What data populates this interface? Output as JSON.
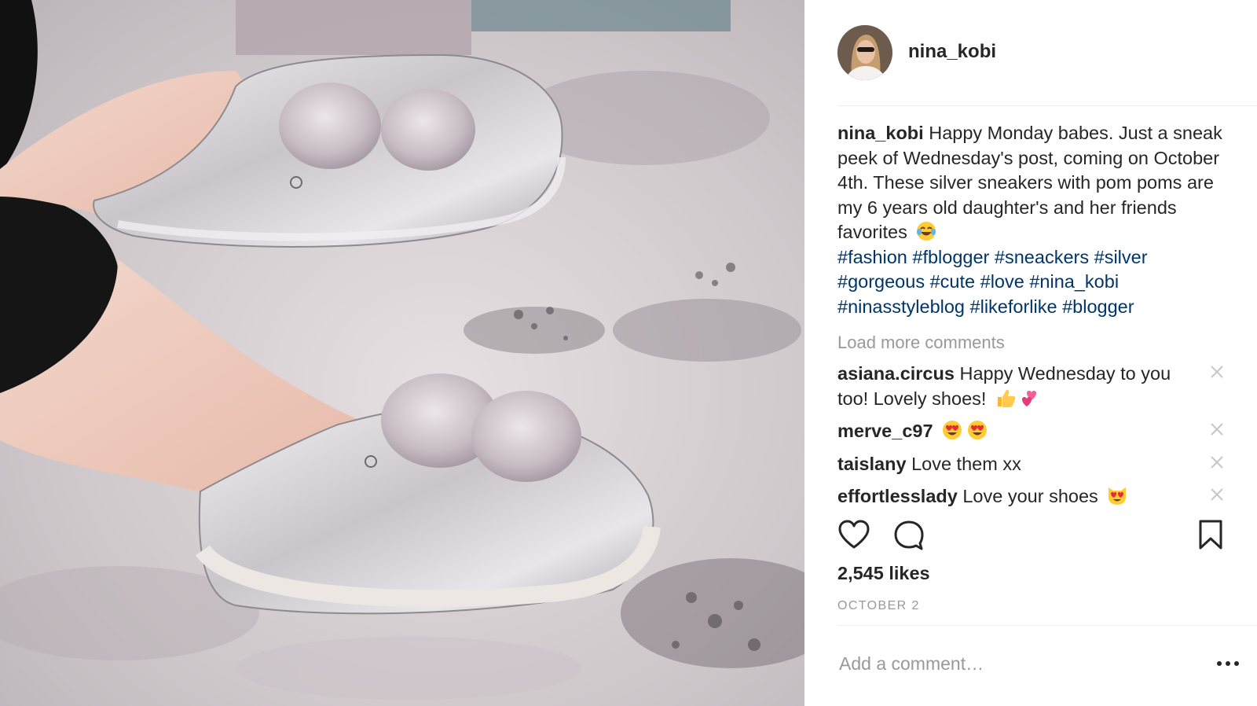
{
  "post": {
    "username": "nina_kobi",
    "caption": {
      "username": "nina_kobi",
      "text": "Happy Monday babes. Just a sneak peek of Wednesday's post, coming on October 4th. These silver sneakers with pom poms are my 6 years old daughter's and her friends favorites",
      "emoji": "face-with-tears-of-joy-emoji",
      "hashtags": [
        "#fashion",
        "#fblogger",
        "#sneackers",
        "#silver",
        "#gorgeous",
        "#cute",
        "#love",
        "#nina_kobi",
        "#ninasstyleblog",
        "#likeforlike",
        "#blogger"
      ]
    },
    "load_more_label": "Load more comments",
    "comments": [
      {
        "username": "asiana.circus",
        "text": "Happy Wednesday to you too! Lovely shoes!",
        "emojis": [
          "thumbs-up-emoji",
          "hearts-emoji"
        ]
      },
      {
        "username": "merve_c97",
        "text": "",
        "emojis": [
          "heart-eyes-emoji",
          "heart-eyes-emoji"
        ]
      },
      {
        "username": "taislany",
        "text": "Love them xx",
        "emojis": []
      },
      {
        "username": "effortlesslady",
        "text": "Love your shoes",
        "emojis": [
          "heart-eyes-cat-emoji"
        ]
      }
    ],
    "likes": "2,545 likes",
    "date": "OCTOBER 2",
    "comment_placeholder": "Add a comment…",
    "icons": [
      "heart-icon",
      "comment-icon",
      "bookmark-icon",
      "close-icon",
      "more-options-icon"
    ],
    "colors": {
      "hashtag": "#003569",
      "text": "#262626",
      "muted": "#999999",
      "divider": "#efefef"
    }
  }
}
